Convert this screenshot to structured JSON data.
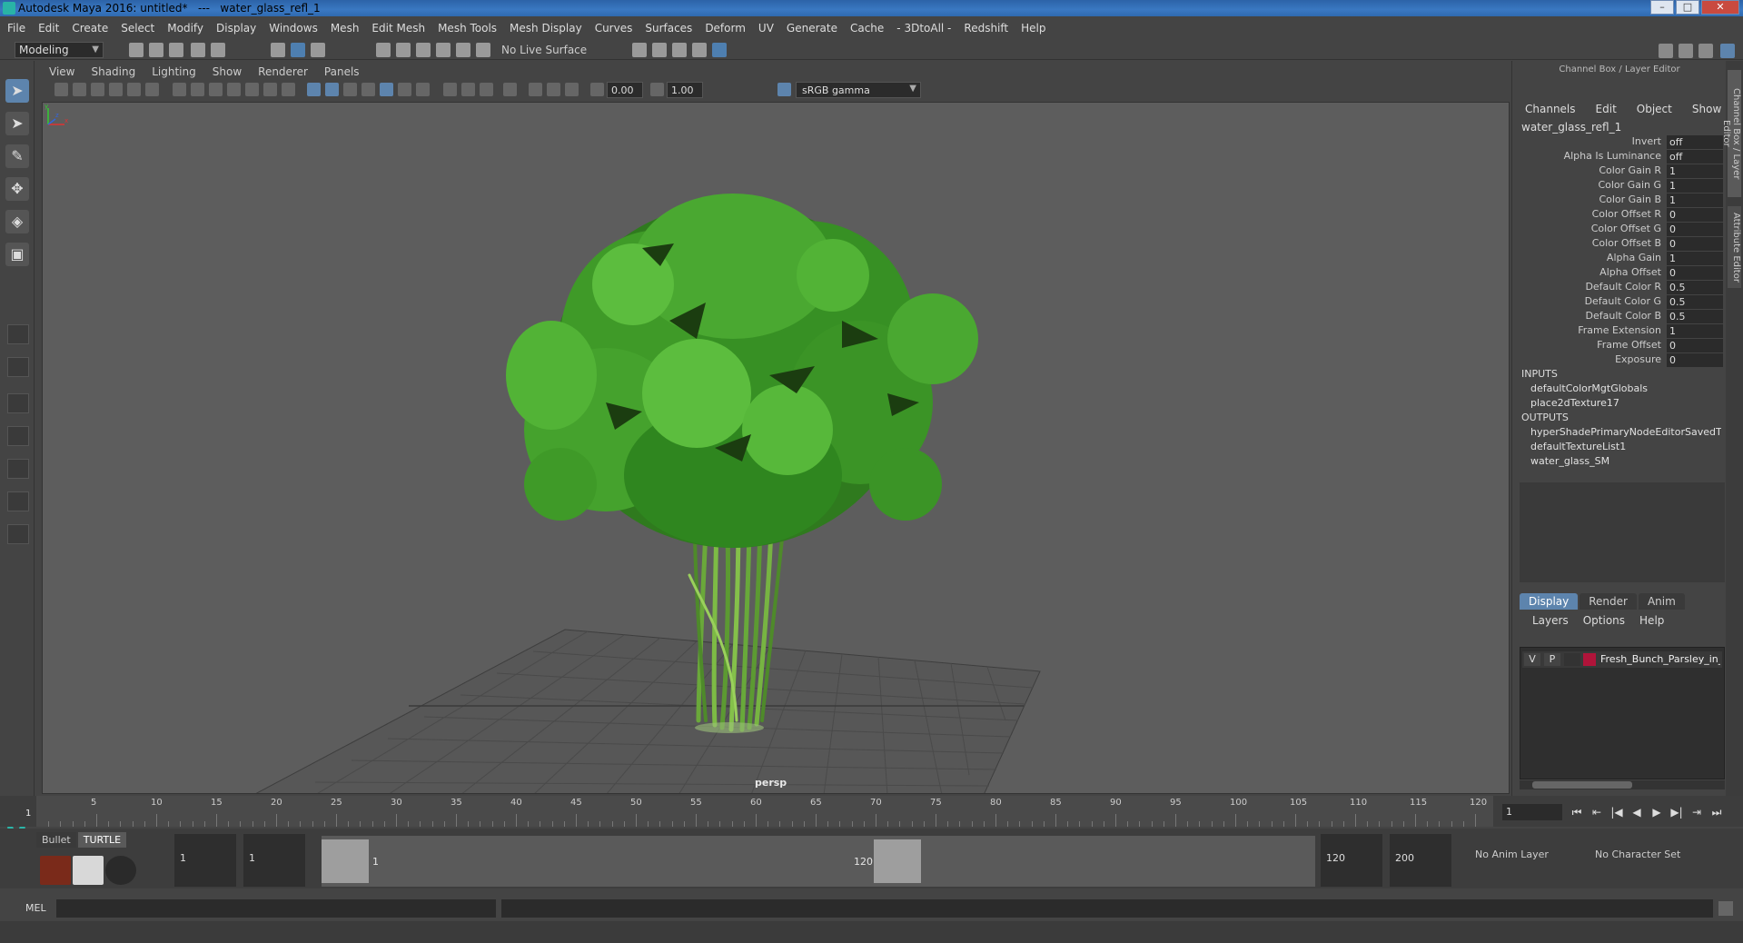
{
  "window": {
    "title": "Autodesk Maya 2016: untitled*   ---   water_glass_refl_1",
    "buttons": [
      "–",
      "□",
      "✕"
    ]
  },
  "menubar": [
    "File",
    "Edit",
    "Create",
    "Select",
    "Modify",
    "Display",
    "Windows",
    "Mesh",
    "Edit Mesh",
    "Mesh Tools",
    "Mesh Display",
    "Curves",
    "Surfaces",
    "Deform",
    "UV",
    "Generate",
    "Cache",
    "- 3DtoAll -",
    "Redshift",
    "Help"
  ],
  "statusline": {
    "mode": "Modeling",
    "live_surface": "No Live Surface"
  },
  "viewport": {
    "menus": [
      "View",
      "Shading",
      "Lighting",
      "Show",
      "Renderer",
      "Panels"
    ],
    "exposure": "0.00",
    "gamma": "1.00",
    "colorspace": "sRGB gamma",
    "camera": "persp",
    "axis_labels": {
      "x": "x",
      "y": "y",
      "z": "z"
    }
  },
  "channel_box": {
    "header": "Channel Box / Layer Editor",
    "menus": [
      "Channels",
      "Edit",
      "Object",
      "Show"
    ],
    "node": "water_glass_refl_1",
    "attributes": [
      {
        "label": "Invert",
        "value": "off"
      },
      {
        "label": "Alpha Is Luminance",
        "value": "off"
      },
      {
        "label": "Color Gain R",
        "value": "1"
      },
      {
        "label": "Color Gain G",
        "value": "1"
      },
      {
        "label": "Color Gain B",
        "value": "1"
      },
      {
        "label": "Color Offset R",
        "value": "0"
      },
      {
        "label": "Color Offset G",
        "value": "0"
      },
      {
        "label": "Color Offset B",
        "value": "0"
      },
      {
        "label": "Alpha Gain",
        "value": "1"
      },
      {
        "label": "Alpha Offset",
        "value": "0"
      },
      {
        "label": "Default Color R",
        "value": "0.5"
      },
      {
        "label": "Default Color G",
        "value": "0.5"
      },
      {
        "label": "Default Color B",
        "value": "0.5"
      },
      {
        "label": "Frame Extension",
        "value": "1"
      },
      {
        "label": "Frame Offset",
        "value": "0"
      },
      {
        "label": "Exposure",
        "value": "0"
      }
    ],
    "inputs_label": "INPUTS",
    "inputs": [
      "defaultColorMgtGlobals",
      "place2dTexture17"
    ],
    "outputs_label": "OUTPUTS",
    "outputs": [
      "hyperShadePrimaryNodeEditorSavedT...",
      "defaultTextureList1",
      "water_glass_SM"
    ]
  },
  "side_tabs": [
    "Channel Box / Layer Editor",
    "Attribute Editor"
  ],
  "layer_editor": {
    "tabs": [
      "Display",
      "Render",
      "Anim"
    ],
    "menus": [
      "Layers",
      "Options",
      "Help"
    ],
    "layers": [
      {
        "visible": "V",
        "playback": "P",
        "name": "Fresh_Bunch_Parsley_in_"
      }
    ]
  },
  "timeline": {
    "ticks": [
      "5",
      "10",
      "15",
      "20",
      "25",
      "30",
      "35",
      "40",
      "45",
      "50",
      "55",
      "60",
      "65",
      "70",
      "75",
      "80",
      "85",
      "90",
      "95",
      "100",
      "105",
      "110",
      "115",
      "120"
    ],
    "current_marker": "1",
    "current_frame": "1",
    "playback_buttons": [
      "⏮",
      "⇤",
      "|◀",
      "◀",
      "▶",
      "▶|",
      "⇥",
      "⏭"
    ]
  },
  "range": {
    "shelf_tabs": [
      "Bullet",
      "TURTLE"
    ],
    "start": "1",
    "playback_start": "1",
    "handle_start": "1",
    "handle_end": "120",
    "playback_end": "120",
    "end": "200",
    "anim_layer": "No Anim Layer",
    "character_set": "No Character Set"
  },
  "cmdline": {
    "label": "MEL"
  }
}
